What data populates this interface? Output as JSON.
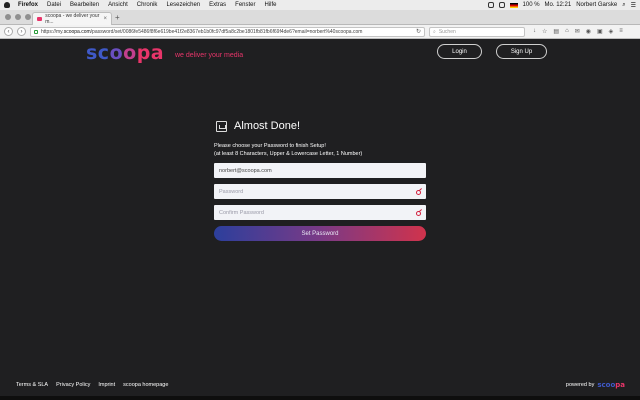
{
  "menubar": {
    "app": "Firefox",
    "items": [
      "Datei",
      "Bearbeiten",
      "Ansicht",
      "Chronik",
      "Lesezeichen",
      "Extras",
      "Fenster",
      "Hilfe"
    ],
    "battery": "100 %",
    "clock": "Mo. 12:21",
    "user": "Norbert Garske"
  },
  "browser": {
    "tab_title": "scoopa - we deliver your m...",
    "tab_close": "×",
    "new_tab": "+",
    "url_prefix": "https://my.",
    "url_domain": "scoopa.com",
    "url_rest": "/password/set/0086fe5486f8f6e619be41f2e8367eb1b0fc97df5a8c2be1801fb81fb6f69f4de6?email=norbert%40scoopa.com",
    "search_placeholder": "Suchen"
  },
  "header": {
    "logo": {
      "s": "sc",
      "o1": "o",
      "o2": "o",
      "pa": "pa"
    },
    "tagline_a": "we deli",
    "tagline_b": "ver",
    "tagline_c": " your media",
    "login_label": "Login",
    "signup_label": "Sign Up"
  },
  "card": {
    "title": "Almost Done!",
    "line1": "Please choose your Password to finish Setup!",
    "line2": "(at least 8 Characters, Upper & Lowercase Letter, 1 Number)",
    "email_value": "norbert@scoopa.com",
    "password_placeholder": "Password",
    "confirm_placeholder": "Confirm Password",
    "submit_label": "Set Password"
  },
  "footer": {
    "links": [
      "Terms & SLA",
      "Privacy Policy",
      "Imprint",
      "scoopa homepage"
    ],
    "powered_by": "powered by",
    "powered_logo_a": "scoo",
    "powered_logo_b": "pa"
  },
  "colors": {
    "background": "#1f1f21",
    "brand_blue": "#3f59c8",
    "brand_pink": "#e8356a",
    "button_gradient_start": "#2c3f9c",
    "button_gradient_end": "#d0334c"
  },
  "icons": [
    "apple-icon",
    "back-icon",
    "forward-icon",
    "reload-icon",
    "lock-icon",
    "download-icon",
    "home-icon",
    "mail-icon",
    "key-icon"
  ]
}
